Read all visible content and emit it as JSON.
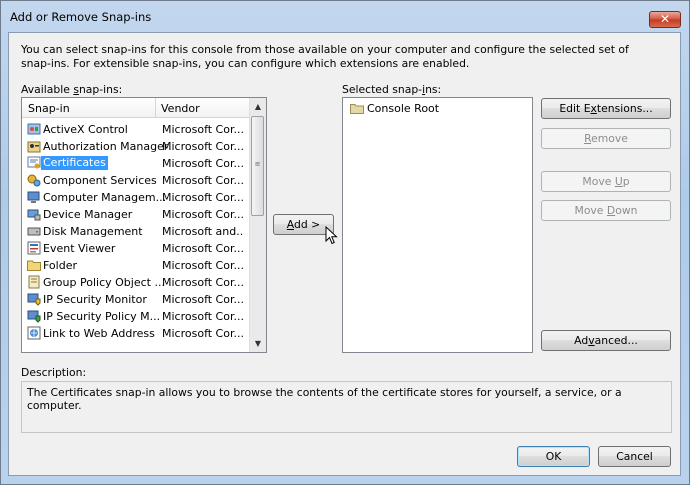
{
  "window": {
    "title": "Add or Remove Snap-ins",
    "close_glyph": "✕"
  },
  "intro_text": "You can select snap-ins for this console from those available on your computer and configure the selected set of snap-ins. For extensible snap-ins, you can configure which extensions are enabled.",
  "available": {
    "label_pre": "Available ",
    "label_u": "s",
    "label_post": "nap-ins:",
    "col_snapin": "Snap-in",
    "col_vendor": "Vendor",
    "rows": [
      {
        "name": "ActiveX Control",
        "vendor": "Microsoft Cor...",
        "icon": "activex-icon",
        "selected": false
      },
      {
        "name": "Authorization Manager",
        "vendor": "Microsoft Cor...",
        "icon": "authorization-icon",
        "selected": false
      },
      {
        "name": "Certificates",
        "vendor": "Microsoft Cor...",
        "icon": "certificate-icon",
        "selected": true
      },
      {
        "name": "Component Services",
        "vendor": "Microsoft Cor...",
        "icon": "component-icon",
        "selected": false
      },
      {
        "name": "Computer Managem...",
        "vendor": "Microsoft Cor...",
        "icon": "computer-icon",
        "selected": false
      },
      {
        "name": "Device Manager",
        "vendor": "Microsoft Cor...",
        "icon": "device-icon",
        "selected": false
      },
      {
        "name": "Disk Management",
        "vendor": "Microsoft and...",
        "icon": "disk-icon",
        "selected": false
      },
      {
        "name": "Event Viewer",
        "vendor": "Microsoft Cor...",
        "icon": "event-icon",
        "selected": false
      },
      {
        "name": "Folder",
        "vendor": "Microsoft Cor...",
        "icon": "folder-icon",
        "selected": false
      },
      {
        "name": "Group Policy Object ...",
        "vendor": "Microsoft Cor...",
        "icon": "policy-icon",
        "selected": false
      },
      {
        "name": "IP Security Monitor",
        "vendor": "Microsoft Cor...",
        "icon": "ipsec-icon",
        "selected": false
      },
      {
        "name": "IP Security Policy M...",
        "vendor": "Microsoft Cor...",
        "icon": "ipsec-policy-icon",
        "selected": false
      },
      {
        "name": "Link to Web Address",
        "vendor": "Microsoft Cor...",
        "icon": "link-icon",
        "selected": false
      }
    ]
  },
  "selected": {
    "label_pre": "Selected snap-",
    "label_u": "i",
    "label_post": "ns:",
    "root": "Console Root"
  },
  "buttons": {
    "add_pre": "",
    "add_u": "A",
    "add_post": "dd >",
    "edit_ext_pre": "Edit E",
    "edit_ext_u": "x",
    "edit_ext_post": "tensions...",
    "remove_pre": "",
    "remove_u": "R",
    "remove_post": "emove",
    "move_up_pre": "Move ",
    "move_up_u": "U",
    "move_up_post": "p",
    "move_down_pre": "Move ",
    "move_down_u": "D",
    "move_down_post": "own",
    "advanced_pre": "Ad",
    "advanced_u": "v",
    "advanced_post": "anced...",
    "ok": "OK",
    "cancel": "Cancel"
  },
  "description": {
    "label": "Description:",
    "text": "The Certificates snap-in allows you to browse the contents of the certificate stores for yourself, a service, or a computer."
  },
  "colors": {
    "selection": "#3399ff",
    "chrome": "#aecbea",
    "close": "#c23a22"
  }
}
